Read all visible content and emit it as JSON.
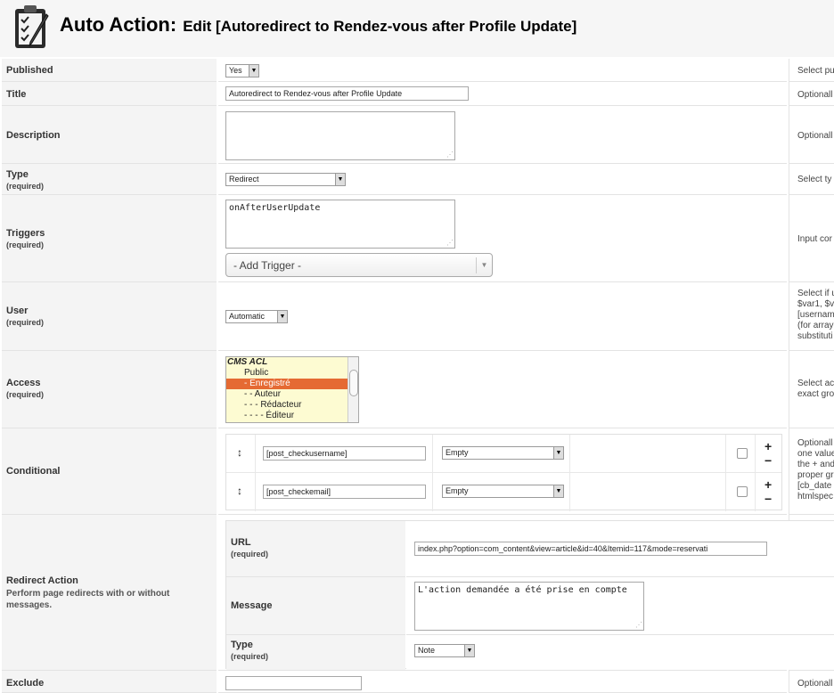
{
  "header": {
    "title_main": "Auto Action:",
    "title_sub": "Edit [Autoredirect to Rendez-vous after Profile Update]",
    "icon": "clipboard-pencil-icon"
  },
  "rows": {
    "published": {
      "label": "Published",
      "value": "Yes",
      "help": "Select pu"
    },
    "title": {
      "label": "Title",
      "value": "Autoredirect to Rendez-vous after Profile Update",
      "help": "Optionall"
    },
    "description": {
      "label": "Description",
      "value": "",
      "help": "Optionall"
    },
    "type": {
      "label": "Type",
      "required": "(required)",
      "value": "Redirect",
      "help": "Select ty"
    },
    "triggers": {
      "label": "Triggers",
      "required": "(required)",
      "value": "onAfterUserUpdate",
      "add_trigger": "- Add Trigger -",
      "help": "Input cor"
    },
    "user": {
      "label": "User",
      "required": "(required)",
      "value": "Automatic",
      "help": [
        "Select if u",
        "$var1, $v",
        "[usernam",
        "(for array",
        "substituti"
      ]
    },
    "access": {
      "label": "Access",
      "required": "(required)",
      "options": [
        "CMS ACL",
        "Public",
        "- Enregistré",
        "- - Auteur",
        "- - - Rédacteur",
        "- - - - Éditeur"
      ],
      "selected": "- Enregistré",
      "help": [
        "Select ac",
        "exact gro"
      ]
    },
    "conditional": {
      "label": "Conditional",
      "conditions": [
        {
          "field": "[post_checkusername]",
          "operator": "Empty"
        },
        {
          "field": "[post_checkemail]",
          "operator": "Empty"
        }
      ],
      "plus": "+",
      "minus": "−",
      "help": [
        "Optionall",
        "one value",
        "the + and",
        "proper gr",
        "[cb_date",
        "htmlspec"
      ]
    },
    "redirect": {
      "label": "Redirect Action",
      "description": "Perform page redirects with or without messages.",
      "url_label": "URL",
      "url_required": "(required)",
      "url_value": "index.php?option=com_content&view=article&id=40&Itemid=117&mode=reservati",
      "message_label": "Message",
      "message_value": "L'action demandée a été prise en compte",
      "type_label": "Type",
      "type_required": "(required)",
      "type_value": "Note"
    },
    "exclude": {
      "label": "Exclude",
      "value": "",
      "help": "Optionall"
    }
  }
}
